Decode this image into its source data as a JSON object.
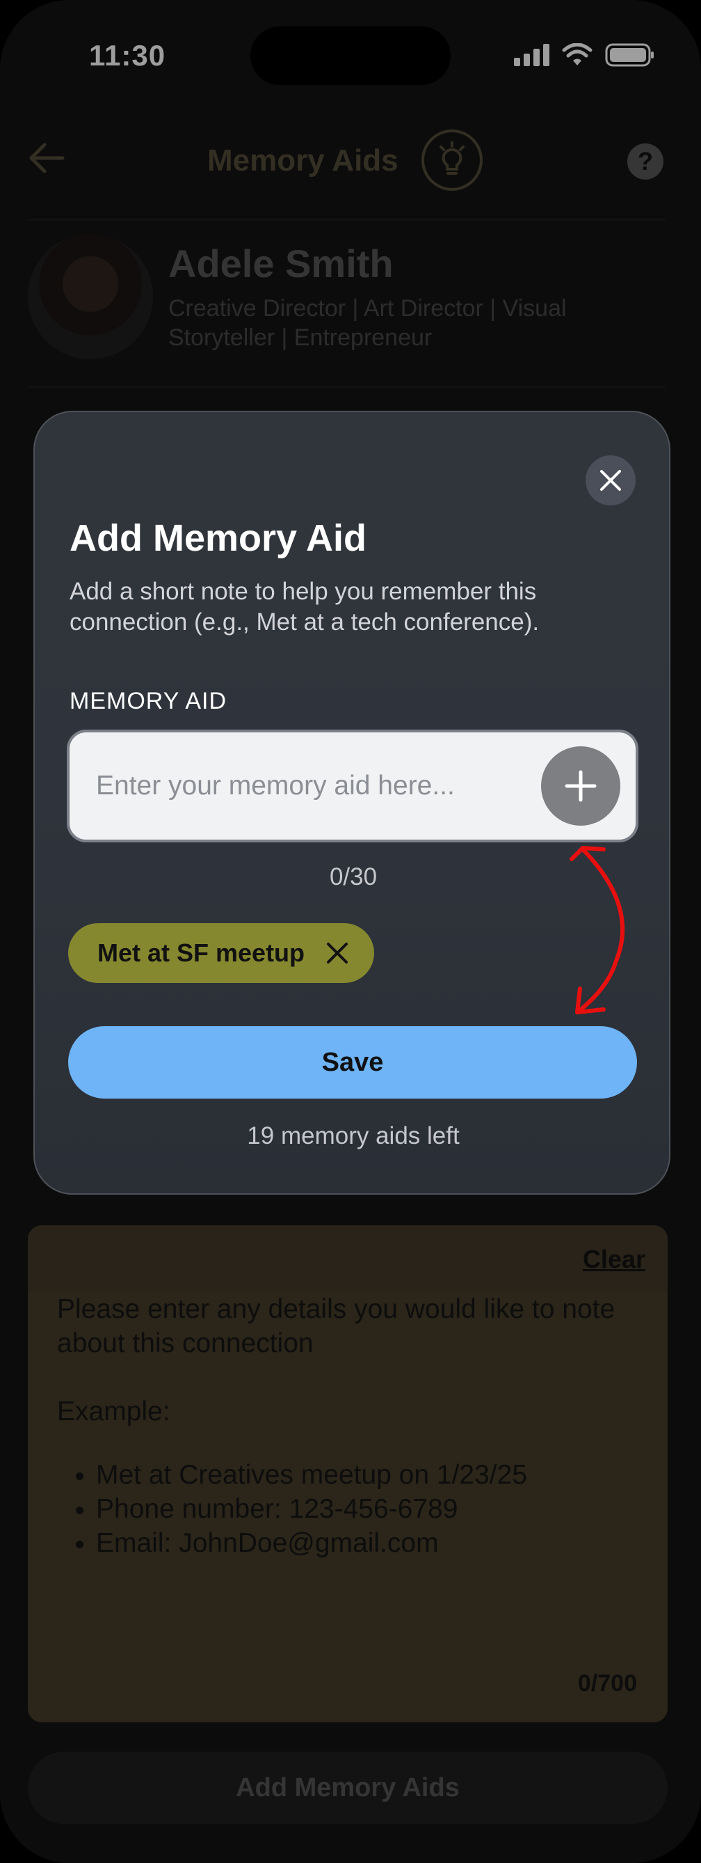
{
  "status_bar": {
    "time": "11:30"
  },
  "header": {
    "title": "Memory Aids",
    "help_label": "?"
  },
  "profile": {
    "name": "Adele Smith",
    "bio": "Creative Director | Art Director | Visual Storyteller | Entrepreneur"
  },
  "notes": {
    "clear_label": "Clear",
    "placeholder": "Please enter any details you would like to note about this connection\n\nExample:",
    "examples": [
      "Met at Creatives meetup on 1/23/25",
      "Phone number: 123-456-6789",
      "Email: JohnDoe@gmail.com"
    ],
    "count": "0/700"
  },
  "bottom_button": {
    "label": "Add Memory Aids"
  },
  "modal": {
    "title": "Add Memory Aid",
    "description": "Add a short note to help you remember this connection (e.g., Met at a tech conference).",
    "field_label": "MEMORY AID",
    "input_placeholder": "Enter your memory aid here...",
    "input_value": "",
    "char_count": "0/30",
    "chips": [
      {
        "label": "Met at SF meetup"
      }
    ],
    "save_label": "Save",
    "remaining_text": "19 memory aids left"
  },
  "colors": {
    "accent_gold": "#e0c98a",
    "chip_olive": "#85882f",
    "save_blue": "#6eb4f7",
    "annotation_red": "#e8100f"
  },
  "icons": [
    "back-arrow-icon",
    "lightbulb-icon",
    "help-icon",
    "close-icon",
    "plus-icon",
    "remove-chip-icon",
    "wifi-icon",
    "battery-icon",
    "signal-icon"
  ]
}
